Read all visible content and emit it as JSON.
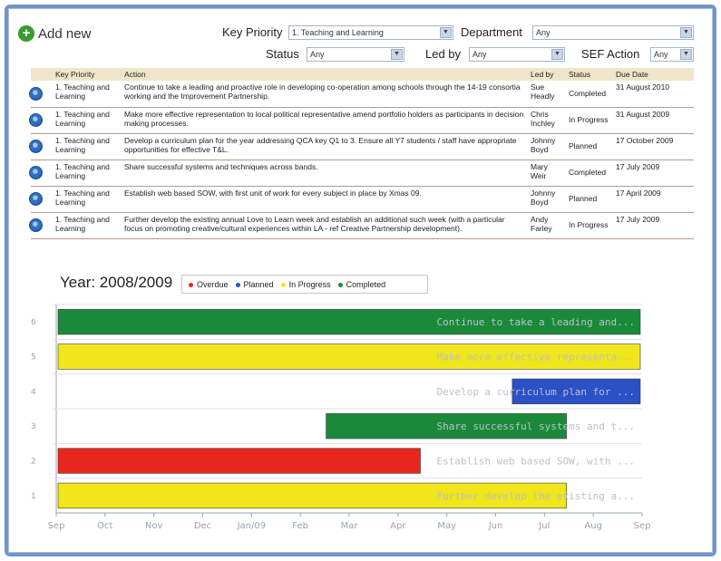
{
  "toolbar": {
    "add_new_label": "Add new",
    "key_priority_label": "Key Priority",
    "key_priority_value": "1. Teaching and Learning",
    "department_label": "Department",
    "department_value": "Any",
    "status_label": "Status",
    "status_value": "Any",
    "led_by_label": "Led by",
    "led_by_value": "Any",
    "sef_action_label": "SEF Action",
    "sef_action_value": "Any"
  },
  "table": {
    "headers": [
      "Key Priority",
      "Action",
      "Led by",
      "Status",
      "Due Date"
    ],
    "rows": [
      {
        "key_priority": "1. Teaching and Learning",
        "action": "Continue to take a leading and proactive role in developing co-operation among schools through the 14-19 consortia working and the Improvement Partnership.",
        "led_by": "Sue Headly",
        "status": "Completed",
        "due_date": "31 August 2010"
      },
      {
        "key_priority": "1. Teaching and Learning",
        "action": "Make more effective representation to local political representative amend portfolio holders as participants in decision making processes.",
        "led_by": "Chris Inchley",
        "status": "In Progress",
        "due_date": "31 August 2009"
      },
      {
        "key_priority": "1. Teaching and Learning",
        "action": "Develop a curriculum plan for the year addressing QCA key Q1 to 3. Ensure all Y7 students / staff have appropriate opportunities for effective T&L.",
        "led_by": "Johnny Boyd",
        "status": "Planned",
        "due_date": "17 October 2009"
      },
      {
        "key_priority": "1. Teaching and Learning",
        "action": "Share successful systems and techniques across bands.",
        "led_by": "Mary Weir",
        "status": "Completed",
        "due_date": "17 July 2009"
      },
      {
        "key_priority": "1. Teaching and Learning",
        "action": "Establish web based SOW, with first unit of work for every subject in place by Xmas 09.",
        "led_by": "Johnny Boyd",
        "status": "Planned",
        "due_date": "17 April 2009"
      },
      {
        "key_priority": "1. Teaching and Learning",
        "action": "Further develop the existing annual Love to Learn week and establish an additional such week (with a particular focus on promoting creative/cultural experiences within LA - ref Creative Partnership development).",
        "led_by": "Andy Farley",
        "status": "In Progress",
        "due_date": "17 July 2009"
      }
    ]
  },
  "timeline": {
    "year_title": "Year: 2008/2009",
    "legend": [
      {
        "label": "Overdue",
        "color": "#e8261c"
      },
      {
        "label": "Planned",
        "color": "#2b51c7"
      },
      {
        "label": "In Progress",
        "color": "#f0e61a"
      },
      {
        "label": "Completed",
        "color": "#1a8a3a"
      }
    ]
  },
  "chart_data": {
    "type": "gantt",
    "x_ticks": [
      "Sep",
      "Oct",
      "Nov",
      "Dec",
      "Jan/09",
      "Feb",
      "Mar",
      "Apr",
      "May",
      "Jun",
      "Jul",
      "Aug",
      "Sep"
    ],
    "y_ticks": [
      "1",
      "2",
      "3",
      "4",
      "5",
      "6"
    ],
    "xlim": [
      "2008-09-01",
      "2009-09-01"
    ],
    "bars": [
      {
        "row": 6,
        "start": "2008-09-01",
        "end": "2009-09-01",
        "status": "Completed",
        "label": "Continue to take a leading and..."
      },
      {
        "row": 5,
        "start": "2008-09-01",
        "end": "2009-09-01",
        "status": "In Progress",
        "label": "Make more effective representa..."
      },
      {
        "row": 4,
        "start": "2009-06-11",
        "end": "2009-09-01",
        "status": "Planned",
        "label": "Develop a curriculum plan for ..."
      },
      {
        "row": 3,
        "start": "2009-02-15",
        "end": "2009-07-17",
        "status": "Completed",
        "label": "Share successful systems and t..."
      },
      {
        "row": 2,
        "start": "2008-09-01",
        "end": "2009-04-17",
        "status": "Overdue",
        "label": "Establish web based SOW, with ..."
      },
      {
        "row": 1,
        "start": "2008-09-01",
        "end": "2009-07-17",
        "status": "In Progress",
        "label": "Further develop the existing a..."
      }
    ],
    "status_colors": {
      "Overdue": "#e8261c",
      "Planned": "#2b51c7",
      "In Progress": "#f0e61a",
      "Completed": "#1a8a3a"
    }
  }
}
